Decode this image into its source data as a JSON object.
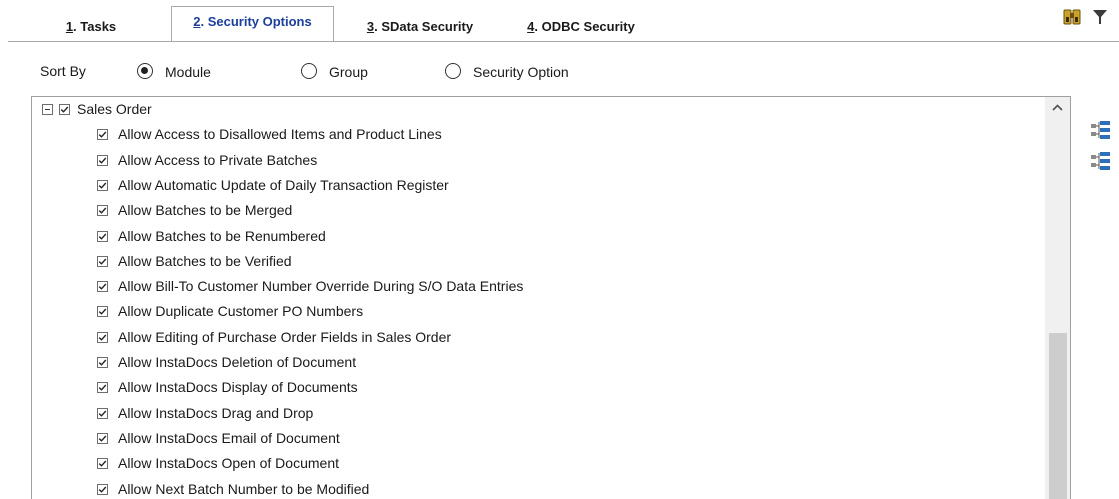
{
  "tabs": [
    {
      "key": "1",
      "label": ". Tasks",
      "active": false
    },
    {
      "key": "2",
      "label": ". Security Options",
      "active": true
    },
    {
      "key": "3",
      "label": ". SData Security",
      "active": false
    },
    {
      "key": "4",
      "label": ". ODBC Security",
      "active": false
    }
  ],
  "toolbar": {
    "icons": [
      "binoculars-icon",
      "filter-icon"
    ]
  },
  "sort_by": {
    "label": "Sort By",
    "options": [
      {
        "label": "Module",
        "selected": true
      },
      {
        "label": "Group",
        "selected": false
      },
      {
        "label": "Security Option",
        "selected": false
      }
    ]
  },
  "tree": {
    "root": {
      "label": "Sales Order",
      "expanded": true,
      "checked": true
    },
    "items": [
      {
        "label": "Allow Access to Disallowed Items and Product Lines",
        "checked": true
      },
      {
        "label": "Allow Access to Private Batches",
        "checked": true
      },
      {
        "label": "Allow Automatic Update of Daily Transaction Register",
        "checked": true
      },
      {
        "label": "Allow Batches to be Merged",
        "checked": true
      },
      {
        "label": "Allow Batches to be Renumbered",
        "checked": true
      },
      {
        "label": "Allow Batches to be Verified",
        "checked": true
      },
      {
        "label": "Allow Bill-To Customer Number Override During S/O Data Entries",
        "checked": true
      },
      {
        "label": "Allow Duplicate Customer PO Numbers",
        "checked": true
      },
      {
        "label": "Allow Editing of Purchase Order Fields in Sales Order",
        "checked": true
      },
      {
        "label": "Allow InstaDocs Deletion of Document",
        "checked": true
      },
      {
        "label": "Allow InstaDocs Display of Documents",
        "checked": true
      },
      {
        "label": "Allow InstaDocs Drag and Drop",
        "checked": true
      },
      {
        "label": "Allow InstaDocs Email of Document",
        "checked": true
      },
      {
        "label": "Allow InstaDocs Open of Document",
        "checked": true
      },
      {
        "label": "Allow Next Batch Number to be Modified",
        "checked": true
      }
    ]
  },
  "side_icons": [
    "expand-all-tree-icon",
    "collapse-all-tree-icon"
  ]
}
